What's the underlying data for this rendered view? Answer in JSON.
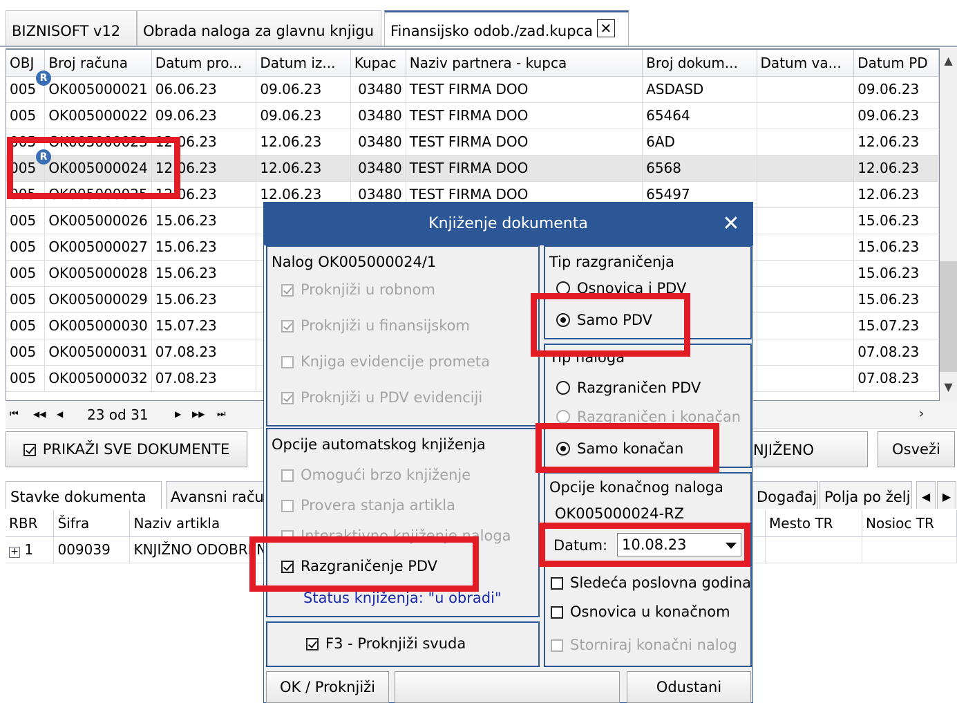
{
  "tabs": {
    "t1": "BIZNISOFT v12",
    "t2": "Obrada naloga za glavnu knjigu",
    "t3": "Finansijsko odob./zad.kupca",
    "close": "✕"
  },
  "grid": {
    "headers": [
      "OBJ",
      "Broj računa",
      "Datum pro...",
      "Datum iz...",
      "Kupac",
      "Naziv partnera - kupca",
      "Broj dokum...",
      "Datum va...",
      "Datum PD"
    ],
    "rows": [
      [
        "005",
        "OK005000021",
        "06.06.23",
        "09.06.23",
        "03480",
        "TEST FIRMA DOO",
        "ASDASD",
        "",
        "09.06.23"
      ],
      [
        "005",
        "OK005000022",
        "09.06.23",
        "09.06.23",
        "03480",
        "TEST FIRMA DOO",
        "65464",
        "",
        "09.06.23"
      ],
      [
        "005",
        "OK005000023",
        "12.06.23",
        "12.06.23",
        "03480",
        "TEST FIRMA DOO",
        "6AD",
        "",
        "12.06.23"
      ],
      [
        "005",
        "OK005000024",
        "12.06.23",
        "12.06.23",
        "03480",
        "TEST FIRMA DOO",
        "6568",
        "",
        "12.06.23"
      ],
      [
        "005",
        "OK005000025",
        "12.06.23",
        "12.06.23",
        "03480",
        "TEST FIRMA DOO",
        "65497",
        "",
        "12.06.23"
      ],
      [
        "005",
        "OK005000026",
        "15.06.23",
        "",
        "",
        "",
        "",
        "",
        "15.06.23"
      ],
      [
        "005",
        "OK005000027",
        "15.06.23",
        "",
        "",
        "",
        "",
        "",
        "15.06.23"
      ],
      [
        "005",
        "OK005000028",
        "15.06.23",
        "",
        "",
        "",
        "",
        "",
        "15.06.23"
      ],
      [
        "005",
        "OK005000029",
        "15.06.23",
        "",
        "",
        "",
        "",
        "",
        "15.06.23"
      ],
      [
        "005",
        "OK005000030",
        "15.07.23",
        "",
        "",
        "",
        "",
        "",
        "15.07.23"
      ],
      [
        "005",
        "OK005000031",
        "07.08.23",
        "",
        "",
        "",
        "",
        "",
        "07.08.23"
      ],
      [
        "005",
        "OK005000032",
        "07.08.23",
        "",
        "",
        "",
        "",
        "",
        "07.08.23"
      ]
    ],
    "badge": "R"
  },
  "nav": {
    "position": "23 od 31",
    "first": "⏮",
    "prev_page": "◀◀",
    "prev": "◀",
    "next": "▶",
    "next_page": "▶▶",
    "last": "⏭"
  },
  "controls": {
    "show_all": "PRIKAŽI SVE DOKUMENTE",
    "posted_partial": "NJIŽENO",
    "refresh": "Osveži"
  },
  "bottom_tabs": {
    "items": "Stavke dokumenta",
    "advance": "Avansni raču",
    "events": "Događaji",
    "fields": "Polja po želj"
  },
  "bottom_grid": {
    "headers": [
      "RBR",
      "Šifra",
      "Naziv artikla",
      "Mesto TR",
      "Nosioc TR"
    ],
    "row": {
      "expand": "+",
      "rbr": "1",
      "sifra": "009039",
      "naziv": "KNJIŽNO ODOBREN"
    }
  },
  "dialog": {
    "title": "Knjiženje dokumenta",
    "close": "✕",
    "nalog": "Nalog OK005000024/1",
    "opt_robni": "Proknjiži u robnom",
    "opt_fin": "Proknjiži u finansijskom",
    "opt_kep": "Knjiga evidencije prometa",
    "opt_pdv": "Proknjiži u PDV evidenciji",
    "auto_title": "Opcije automatskog knjiženja",
    "auto_fast": "Omogući brzo knjiženje",
    "auto_stock": "Provera stanja artikla",
    "auto_interactive": "Interaktivno knjiženje naloga",
    "auto_razgr": "Razgraničenje PDV",
    "status": "Status knjiženja: \"u obradi\"",
    "f3": "F3 - Proknjiži svuda",
    "tip_razgr_title": "Tip razgraničenja",
    "tip_razgr_1": "Osnovica i PDV",
    "tip_razgr_2": "Samo PDV",
    "tip_naloga_title": "Tip naloga",
    "tip_naloga_1": "Razgraničen PDV",
    "tip_naloga_2": "Razgraničen i konačan",
    "tip_naloga_3": "Samo konačan",
    "konacni_title": "Opcije konačnog naloga",
    "konacni_nalog": "OK005000024-RZ",
    "datum_label": "Datum:",
    "datum_value": "10.08.23",
    "next_year": "Sledeća poslovna godina",
    "base_final": "Osnovica u konačnom",
    "storno": "Storniraj konačni nalog",
    "ok": "OK / Proknjiži",
    "cancel": "Odustani"
  },
  "colors": {
    "dialog_title_bg": "#2b5797",
    "highlight": "#e21b24"
  }
}
